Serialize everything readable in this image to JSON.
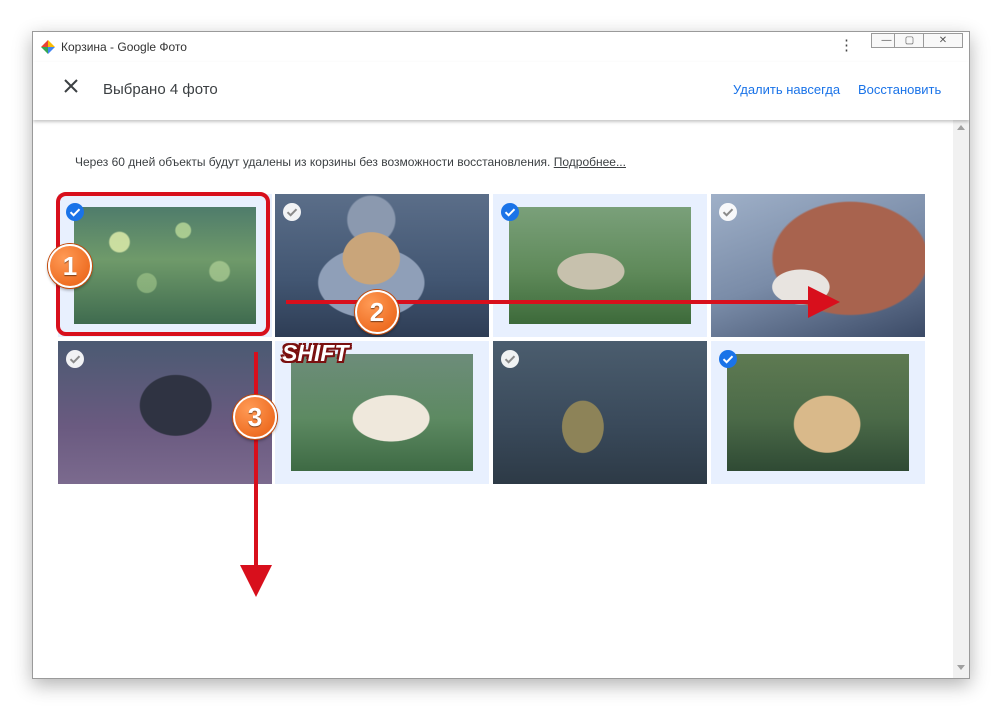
{
  "window": {
    "title": "Корзина - Google Фото",
    "buttons": [
      "minimize",
      "maximize",
      "close"
    ]
  },
  "appbar": {
    "selected_count": "Выбрано 4 фото",
    "delete_forever": "Удалить навсегда",
    "restore": "Восстановить"
  },
  "notice": {
    "text": "Через 60 дней объекты будут удалены из корзины без возможности восстановления.",
    "link": "Подробнее..."
  },
  "photos": [
    {
      "subject": "grass with bokeh",
      "selected": true
    },
    {
      "subject": "dog in costume",
      "selected": false
    },
    {
      "subject": "guinea pig",
      "selected": true
    },
    {
      "subject": "red panda",
      "selected": false
    },
    {
      "subject": "three dogs",
      "selected": false
    },
    {
      "subject": "hamster",
      "selected": false
    },
    {
      "subject": "monkey",
      "selected": false
    },
    {
      "subject": "golden retriever with butterfly",
      "selected": true
    }
  ],
  "annotations": {
    "step1": "1",
    "step2": "2",
    "step3": "3",
    "shift_label": "SHIFT"
  },
  "colors": {
    "accent": "#1a73e8",
    "selected_bg": "#e8f0fe",
    "annotation_red": "#d80f1c",
    "badge_orange": "#e85d10"
  }
}
